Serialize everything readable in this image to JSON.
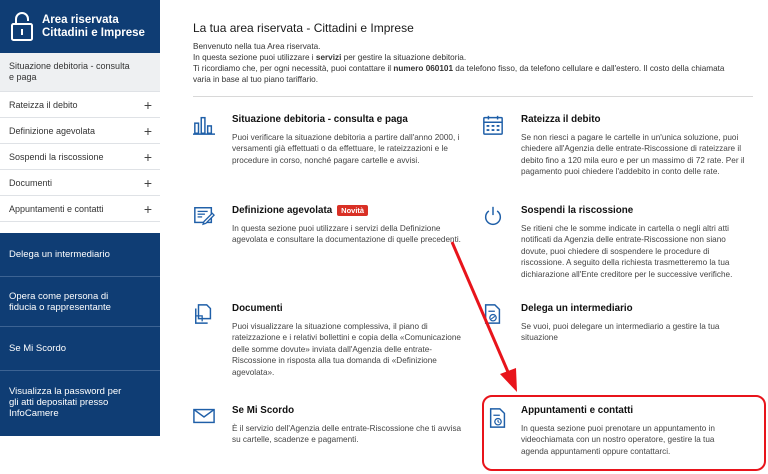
{
  "sidebar": {
    "header_title_line1": "Area riservata",
    "header_title_line2": "Cittadini e Imprese",
    "menu": [
      {
        "label_line1": "Situazione debitoria - consulta",
        "label_line2": "e paga",
        "expandable": false
      },
      {
        "label": "Rateizza il debito",
        "expandable": true,
        "toggle": "+"
      },
      {
        "label": "Definizione agevolata",
        "expandable": true,
        "toggle": "+"
      },
      {
        "label": "Sospendi la riscossione",
        "expandable": true,
        "toggle": "+"
      },
      {
        "label": "Documenti",
        "expandable": true,
        "toggle": "+"
      },
      {
        "label": "Appuntamenti e contatti",
        "expandable": true,
        "toggle": "+"
      }
    ],
    "links": [
      {
        "line1": "Delega un intermediario",
        "line2": "",
        "line3": ""
      },
      {
        "line1": "Opera come persona di",
        "line2": "fiducia o rappresentante",
        "line3": ""
      },
      {
        "line1": "Se Mi Scordo",
        "line2": "",
        "line3": ""
      },
      {
        "line1": "Visualizza la password per",
        "line2": "gli atti depositati presso",
        "line3": "InfoCamere"
      }
    ]
  },
  "main": {
    "title": "La tua area riservata - Cittadini e Imprese",
    "intro_line1": "Benvenuto nella tua Area riservata.",
    "intro_line2_a": "In questa sezione puoi utilizzare i ",
    "intro_line2_b": "servizi",
    "intro_line2_c": " per gestire la situazione debitoria.",
    "intro_line3_a": "Ti ricordiamo che, per ogni necessità, puoi contattare il ",
    "intro_line3_b": "numero 060101",
    "intro_line3_c": " da telefono fisso, da telefono cellulare e dall'estero. Il costo della chiamata",
    "intro_line4": "varia in base al tuo piano tariffario.",
    "cards": [
      {
        "title": "Situazione debitoria - consulta e paga",
        "badge": "",
        "icon": "bar-chart-icon",
        "desc": "Puoi verificare la situazione debitoria a partire dall'anno 2000, i versamenti già effettuati o da effettuare, le rateizzazioni e le procedure in corso, nonché pagare cartelle e avvisi."
      },
      {
        "title": "Rateizza il debito",
        "badge": "",
        "icon": "calendar-icon",
        "desc": "Se non riesci a pagare le cartelle in un'unica soluzione, puoi chiedere all'Agenzia delle entrate-Riscossione di rateizzare il debito fino a 120 mila euro e per un massimo di 72 rate. Per il pagamento puoi chiedere l'addebito in conto delle rate."
      },
      {
        "title": "Definizione agevolata",
        "badge": "Novità",
        "icon": "form-pen-icon",
        "desc": "In questa sezione puoi utilizzare i servizi della Definizione agevolata e consultare la documentazione di quelle precedenti."
      },
      {
        "title": "Sospendi la riscossione",
        "badge": "",
        "icon": "power-icon",
        "desc": "Se ritieni che le somme indicate in cartella o negli altri atti notificati da Agenzia delle entrate-Riscossione non siano dovute, puoi chiedere di sospendere le procedure di riscossione. A seguito della richiesta trasmetteremo la tua dichiarazione all'Ente creditore per le successive verifiche."
      },
      {
        "title": "Documenti",
        "badge": "",
        "icon": "documents-icon",
        "desc": "Puoi visualizzare la situazione complessiva, il piano di rateizzazione e i relativi bollettini e copia della «Comunicazione delle somme dovute» inviata dall'Agenzia delle entrate-Riscossione in risposta alla tua domanda di «Definizione agevolata»."
      },
      {
        "title": "Delega un intermediario",
        "badge": "",
        "icon": "delegate-document-icon",
        "desc": "Se vuoi, puoi delegare un intermediario a gestire la tua situazione"
      },
      {
        "title": "Se Mi Scordo",
        "badge": "",
        "icon": "envelope-icon",
        "desc": "È il servizio dell'Agenzia delle entrate-Riscossione che ti avvisa su cartelle, scadenze e pagamenti."
      },
      {
        "title": "Appuntamenti e contatti",
        "badge": "",
        "icon": "appointment-document-icon",
        "desc": "In questa sezione puoi prenotare un appuntamento in videochiamata con un nostro operatore, gestire la tua agenda appuntamenti oppure contattarci."
      }
    ]
  },
  "colors": {
    "brand_blue": "#0f3d74",
    "icon_blue": "#1f5fa8",
    "badge_red": "#d93025",
    "annotation_red": "#e8141b"
  }
}
